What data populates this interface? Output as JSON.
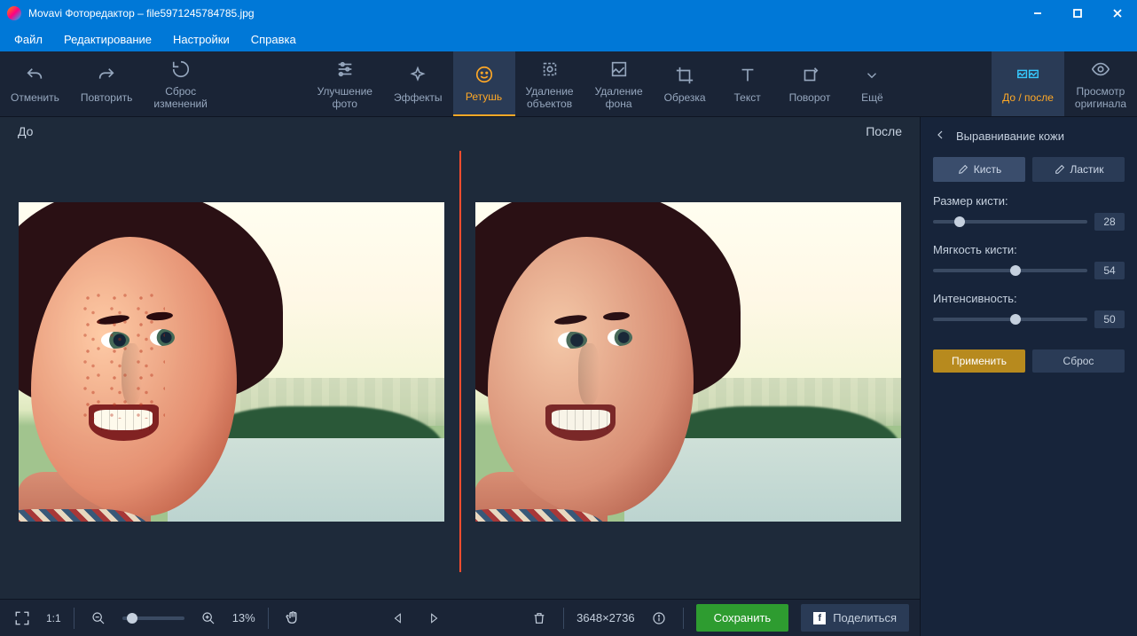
{
  "window": {
    "title": "Movavi Фоторедактор – file5971245784785.jpg"
  },
  "menu": {
    "file": "Файл",
    "edit": "Редактирование",
    "settings": "Настройки",
    "help": "Справка"
  },
  "tools": {
    "undo": "Отменить",
    "redo": "Повторить",
    "reset": "Сброс\nизменений",
    "enhance": "Улучшение\nфото",
    "effects": "Эффекты",
    "retouch": "Ретушь",
    "obj_remove": "Удаление\nобъектов",
    "bg_remove": "Удаление\nфона",
    "crop": "Обрезка",
    "text": "Текст",
    "rotate": "Поворот",
    "more": "Ещё",
    "before_after": "До / после",
    "view_original": "Просмотр\nоригинала"
  },
  "canvas": {
    "before": "До",
    "after": "После"
  },
  "status": {
    "zoom": "13%",
    "dimensions": "3648×2736",
    "onetoone": "1:1"
  },
  "actions": {
    "save": "Сохранить",
    "share": "Поделиться"
  },
  "panel": {
    "title": "Выравнивание кожи",
    "brush": "Кисть",
    "eraser": "Ластик",
    "sliders": [
      {
        "label": "Размер кисти:",
        "value": 28,
        "pos": 14
      },
      {
        "label": "Мягкость кисти:",
        "value": 54,
        "pos": 50
      },
      {
        "label": "Интенсивность:",
        "value": 50,
        "pos": 50
      }
    ],
    "apply": "Применить",
    "reset": "Сброс"
  }
}
